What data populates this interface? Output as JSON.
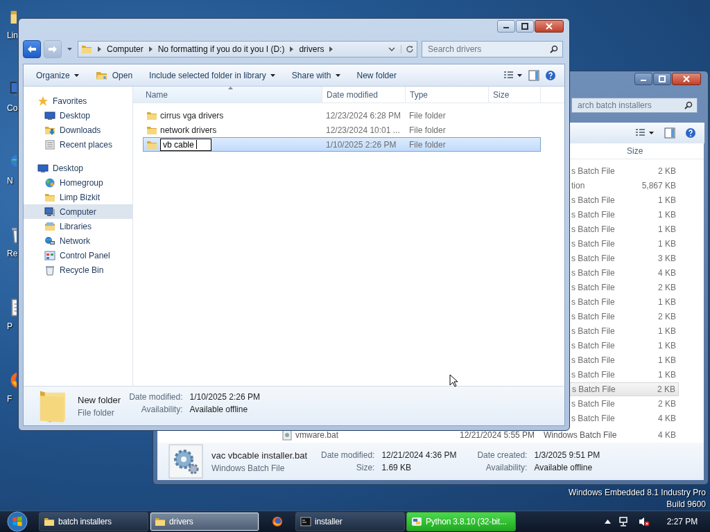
{
  "desktop": {
    "icons": [
      {
        "label": "Lin",
        "kind": "folder"
      },
      {
        "label": "Co",
        "kind": "computer"
      },
      {
        "label": "N",
        "kind": "network"
      },
      {
        "label": "Re",
        "kind": "bin"
      },
      {
        "label": "P",
        "kind": "doc"
      },
      {
        "label": "F",
        "kind": "browser"
      }
    ],
    "os_info": [
      "Windows Embedded 8.1 Industry Pro",
      "Build 9600"
    ]
  },
  "back_window": {
    "search": {
      "placeholder": "arch batch installers"
    },
    "columns": [
      "Size"
    ],
    "rows": [
      {
        "type": "s Batch File",
        "size": "2 KB",
        "hovered": false
      },
      {
        "type": "tion",
        "size": "5,867 KB",
        "hovered": false
      },
      {
        "type": "s Batch File",
        "size": "1 KB",
        "hovered": false
      },
      {
        "type": "s Batch File",
        "size": "1 KB",
        "hovered": false
      },
      {
        "type": "s Batch File",
        "size": "1 KB",
        "hovered": false
      },
      {
        "type": "s Batch File",
        "size": "1 KB",
        "hovered": false
      },
      {
        "type": "s Batch File",
        "size": "3 KB",
        "hovered": false
      },
      {
        "type": "s Batch File",
        "size": "4 KB",
        "hovered": false
      },
      {
        "type": "s Batch File",
        "size": "2 KB",
        "hovered": false
      },
      {
        "type": "s Batch File",
        "size": "1 KB",
        "hovered": false
      },
      {
        "type": "s Batch File",
        "size": "2 KB",
        "hovered": false
      },
      {
        "type": "s Batch File",
        "size": "1 KB",
        "hovered": false
      },
      {
        "type": "s Batch File",
        "size": "1 KB",
        "hovered": false
      },
      {
        "type": "s Batch File",
        "size": "1 KB",
        "hovered": false
      },
      {
        "type": "s Batch File",
        "size": "1 KB",
        "hovered": false
      },
      {
        "type": "s Batch File",
        "size": "2 KB",
        "hovered": true
      },
      {
        "type": "s Batch File",
        "size": "2 KB",
        "hovered": false
      },
      {
        "type": "s Batch File",
        "size": "4 KB",
        "hovered": false
      }
    ],
    "bottom_row": {
      "name": "vmware.bat",
      "date": "12/21/2024 5:55 PM",
      "type": "Windows Batch File",
      "size": "4 KB"
    },
    "details": {
      "name": "vac vbcable installer.bat",
      "type": "Windows Batch File",
      "fields": [
        {
          "label": "Date modified:",
          "value": "12/21/2024 4:36 PM"
        },
        {
          "label": "Date created:",
          "value": "1/3/2025 9:51 PM"
        },
        {
          "label": "Size:",
          "value": "1.69 KB"
        },
        {
          "label": "Availability:",
          "value": "Available offline"
        }
      ]
    }
  },
  "front_window": {
    "nav": {
      "back_enabled": true,
      "forward_enabled": false
    },
    "breadcrumbs": [
      "Computer",
      "No formatting if you do it you I (D:)",
      "drivers"
    ],
    "search": {
      "placeholder": "Search drivers"
    },
    "commands": [
      {
        "label": "Organize",
        "dropdown": true,
        "icon": false
      },
      {
        "label": "Open",
        "dropdown": false,
        "icon": true
      },
      {
        "label": "Include selected folder in library",
        "dropdown": true,
        "icon": false
      },
      {
        "label": "Share with",
        "dropdown": true,
        "icon": false
      },
      {
        "label": "New folder",
        "dropdown": false,
        "icon": false
      }
    ],
    "sidebar": {
      "groups": [
        {
          "label": "Favorites",
          "kind": "star",
          "selected": false,
          "children": [
            {
              "label": "Desktop",
              "kind": "desktop",
              "selected": false
            },
            {
              "label": "Downloads",
              "kind": "downloads",
              "selected": false
            },
            {
              "label": "Recent places",
              "kind": "recent",
              "selected": false
            }
          ]
        },
        {
          "label": "Desktop",
          "kind": "desktop",
          "selected": false,
          "children": [
            {
              "label": "Homegroup",
              "kind": "homegroup",
              "selected": false
            },
            {
              "label": "Limp Bizkit",
              "kind": "folder",
              "selected": false
            },
            {
              "label": "Computer",
              "kind": "computer",
              "selected": true
            },
            {
              "label": "Libraries",
              "kind": "library",
              "selected": false
            },
            {
              "label": "Network",
              "kind": "network",
              "selected": false
            },
            {
              "label": "Control Panel",
              "kind": "panel",
              "selected": false
            },
            {
              "label": "Recycle Bin",
              "kind": "bin",
              "selected": false
            }
          ]
        }
      ]
    },
    "columns": [
      {
        "label": "Name",
        "sorted": true
      },
      {
        "label": "Date modified",
        "sorted": false
      },
      {
        "label": "Type",
        "sorted": false
      },
      {
        "label": "Size",
        "sorted": false
      }
    ],
    "rows": [
      {
        "name": "cirrus vga drivers",
        "date": "12/23/2024 6:28 PM",
        "type": "File folder",
        "selected": false,
        "editing": false
      },
      {
        "name": "network drivers",
        "date": "12/23/2024 10:01 ...",
        "type": "File folder",
        "selected": false,
        "editing": false
      },
      {
        "name": "vb cable",
        "date": "1/10/2025 2:26 PM",
        "type": "File folder",
        "selected": true,
        "editing": true
      }
    ],
    "details": {
      "name": "New folder",
      "type": "File folder",
      "fields": [
        {
          "label": "Date modified:",
          "value": "1/10/2025 2:26 PM"
        },
        {
          "label": "Availability:",
          "value": "Available offline"
        }
      ]
    }
  },
  "taskbar": {
    "buttons": [
      {
        "label": "batch installers",
        "kind": "folder",
        "selected": false,
        "flashing": false
      },
      {
        "label": "drivers",
        "kind": "folder",
        "selected": true,
        "flashing": false
      },
      {
        "kind": "browser",
        "selected": false,
        "flashing": false
      },
      {
        "label": "installer",
        "kind": "console",
        "selected": false,
        "flashing": false
      },
      {
        "label": "Python 3.8.10 (32-bit...",
        "kind": "python",
        "selected": false,
        "flashing": true
      }
    ],
    "clock": "2:27 PM"
  }
}
